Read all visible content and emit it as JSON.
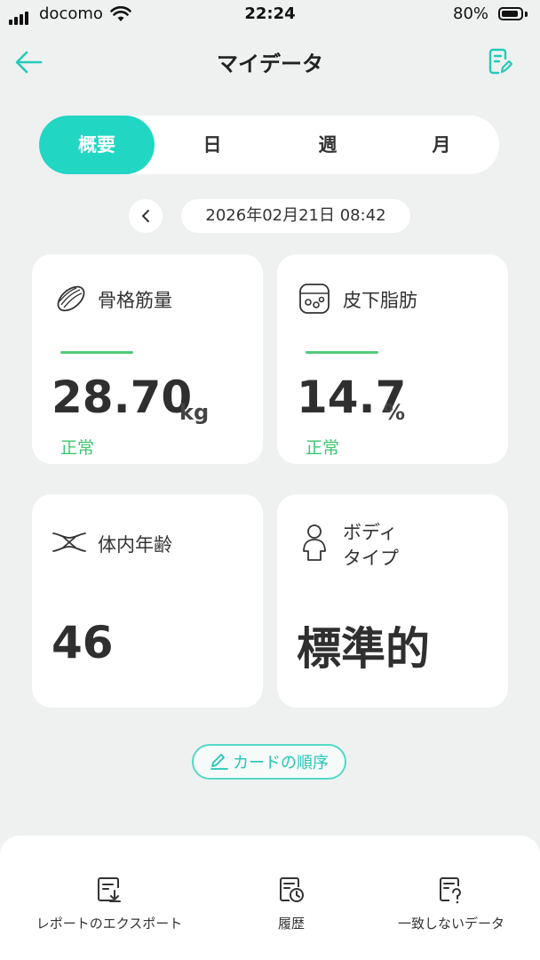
{
  "status_bar": {
    "carrier": "docomo",
    "time": "22:24",
    "battery": "80%"
  },
  "header": {
    "title": "マイデータ"
  },
  "tabs": [
    {
      "label": "概要",
      "active": true
    },
    {
      "label": "日",
      "active": false
    },
    {
      "label": "週",
      "active": false
    },
    {
      "label": "月",
      "active": false
    }
  ],
  "date": {
    "text": "2026年02月21日 08:42"
  },
  "cards": {
    "muscle": {
      "label": "骨格筋量",
      "value": "28.70",
      "unit": "kg",
      "status": "正常",
      "icon": "muscle-icon"
    },
    "fat": {
      "label": "皮下脂肪",
      "value": "14.7",
      "unit": "%",
      "status": "正常",
      "icon": "fat-cells-icon"
    },
    "age": {
      "label": "体内年齢",
      "value": "46",
      "icon": "body-age-icon"
    },
    "bodytype": {
      "label_line1": "ボディ",
      "label_line2": "タイプ",
      "value": "標準的",
      "icon": "person-icon"
    }
  },
  "order_button": {
    "label": "カードの順序"
  },
  "bottom_bar": [
    {
      "label": "レポートのエクスポート",
      "icon": "export-report-icon"
    },
    {
      "label": "履歴",
      "icon": "history-icon"
    },
    {
      "label": "一致しないデータ",
      "icon": "unmatched-data-icon"
    }
  ],
  "colors": {
    "accent": "#22d6c4",
    "status_green": "#3ec66f",
    "background": "#eff1f0"
  }
}
